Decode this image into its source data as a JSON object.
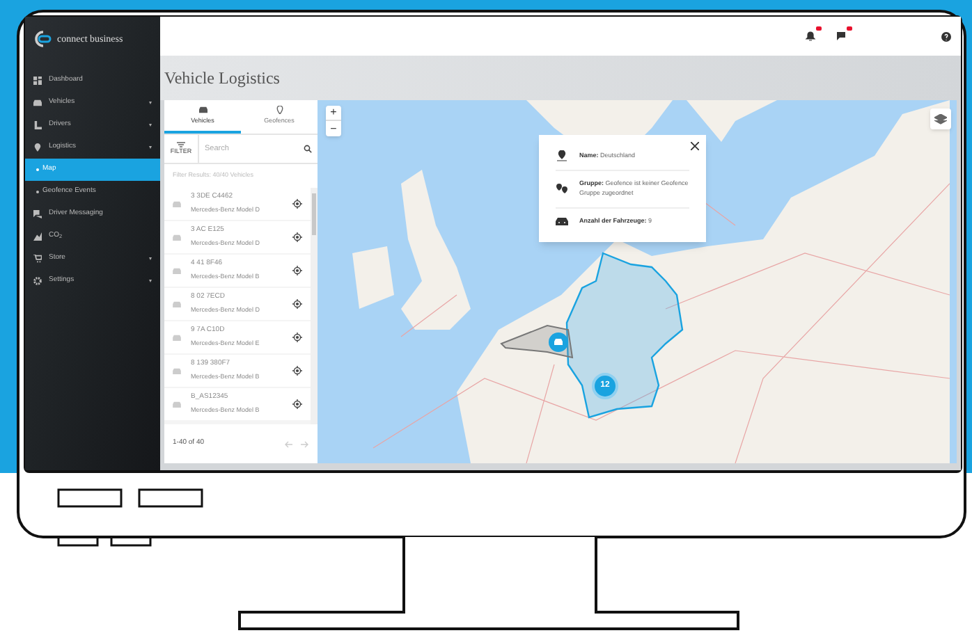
{
  "logo": {
    "text": "connect business"
  },
  "sidebar": {
    "items": [
      {
        "label": "Dashboard",
        "expandable": false,
        "selected": false
      },
      {
        "label": "Vehicles",
        "expandable": true,
        "selected": false
      },
      {
        "label": "Drivers",
        "expandable": true,
        "selected": false
      },
      {
        "label": "Logistics",
        "expandable": true,
        "selected": false,
        "children": [
          {
            "label": "Map",
            "selected": true
          },
          {
            "label": "Geofence Events",
            "selected": false
          }
        ]
      },
      {
        "label": "Driver Messaging",
        "expandable": false,
        "selected": false
      },
      {
        "label": "CO$_{2}$",
        "expandable": false,
        "selected": false
      },
      {
        "label": "Store",
        "expandable": true,
        "selected": false
      },
      {
        "label": "Settings",
        "expandable": true,
        "selected": false
      }
    ]
  },
  "header": {
    "notification_badge": true,
    "message_badge": true
  },
  "page_title": "Vehicle Logistics",
  "panel": {
    "tabs": [
      {
        "label": "Vehicles",
        "selected": true
      },
      {
        "label": "Geofences",
        "selected": false
      }
    ],
    "filter_label": "FILTER",
    "search": {
      "placeholder": "Search"
    },
    "filter_results": "Filter Results: 40/40 Vehicles",
    "vehicles": [
      {
        "plate": "3 3DE C4462",
        "model": "Mercedes-Benz Model D"
      },
      {
        "plate": "3 AC E125",
        "model": "Mercedes-Benz Model D"
      },
      {
        "plate": "4 41 8F46",
        "model": "Mercedes-Benz Model B"
      },
      {
        "plate": "8 02 7ECD",
        "model": "Mercedes-Benz Model D"
      },
      {
        "plate": "9 7A C10D",
        "model": "Mercedes-Benz Model E"
      },
      {
        "plate": "8 139 380F7",
        "model": "Mercedes-Benz Model B"
      },
      {
        "plate": "B_AS12345",
        "model": "Mercedes-Benz Model B"
      }
    ],
    "pagination": "1-40 of 40"
  },
  "map": {
    "zoom_in": "+",
    "zoom_out": "−",
    "cluster_count": "12",
    "popup": [
      {
        "label": "Name:",
        "value": "Deutschland"
      },
      {
        "label": "Gruppe:",
        "value": "Geofence ist keiner Geofence Gruppe zugeordnet"
      },
      {
        "label": "Anzahl der Fahrzeuge:",
        "value": "9"
      }
    ]
  }
}
